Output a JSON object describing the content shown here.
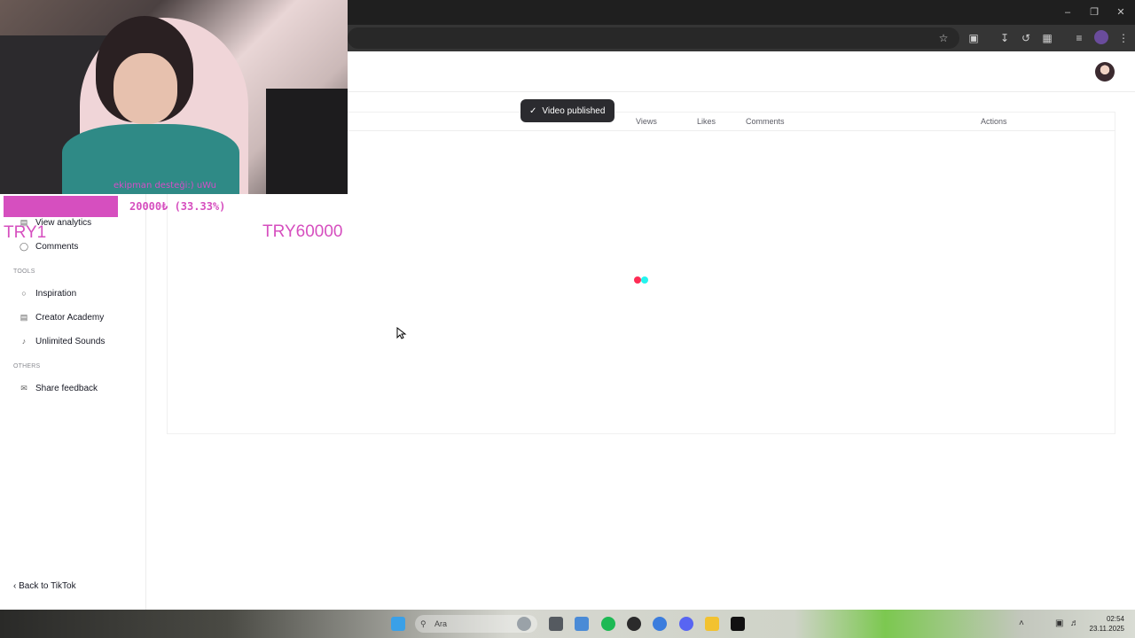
{
  "toast": {
    "label": "Video published"
  },
  "table": {
    "columns": [
      "Views",
      "Likes",
      "Comments"
    ],
    "actions_label": "Actions"
  },
  "sidebar": {
    "items_top": [
      {
        "label": "View analytics",
        "icon": "chart-icon"
      },
      {
        "label": "Comments",
        "icon": "comment-icon"
      }
    ],
    "tools_heading": "TOOLS",
    "tools": [
      {
        "label": "Inspiration",
        "icon": "bulb-icon"
      },
      {
        "label": "Creator Academy",
        "icon": "book-icon"
      },
      {
        "label": "Unlimited Sounds",
        "icon": "music-note-icon"
      }
    ],
    "others_heading": "OTHERS",
    "others": [
      {
        "label": "Share feedback",
        "icon": "mail-icon"
      }
    ],
    "back_label": "Back to TikTok"
  },
  "overlay": {
    "caption": "ekipman desteği:) uWu",
    "goal_text": "20000₺ (33.33%)",
    "goal_progress_pct": 33.33,
    "goal_min": "TRY1",
    "goal_max": "TRY60000"
  },
  "taskbar": {
    "search_placeholder": "Ara",
    "time": "02:54",
    "date": "23.11.2025"
  },
  "colors": {
    "accent_pink": "#d64fbf",
    "tiktok_red": "#fe2c55",
    "tiktok_cyan": "#25f4ee",
    "toast_bg": "#2b2b2f"
  }
}
